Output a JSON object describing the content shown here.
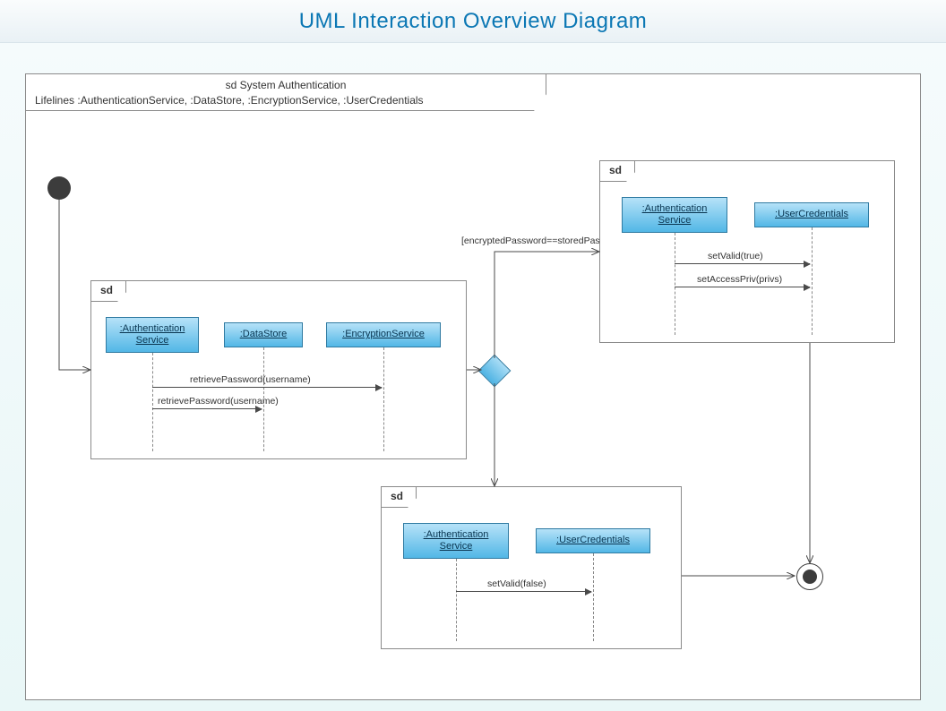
{
  "title": "UML Interaction Overview Diagram",
  "frame": {
    "header_line1": "sd System Authentication",
    "header_line2": "Lifelines :AuthenticationService, :DataStore, :EncryptionService, :UserCredentials"
  },
  "sd1": {
    "tab": "sd",
    "lifeline_auth": ":Authentication\nService",
    "lifeline_data": ":DataStore",
    "lifeline_enc": ":EncryptionService",
    "msg1": "retrievePassword(username)",
    "msg2": "retrievePassword(username)"
  },
  "sd2": {
    "tab": "sd",
    "lifeline_auth": ":Authentication\nService",
    "lifeline_user": ":UserCredentials",
    "msg1": "setValid(true)",
    "msg2": "setAccessPriv(privs)"
  },
  "sd3": {
    "tab": "sd",
    "lifeline_auth": ":Authentication\nService",
    "lifeline_user": ":UserCredentials",
    "msg1": "setValid(false)"
  },
  "guard": "[encryptedPassword==storedPassword]"
}
